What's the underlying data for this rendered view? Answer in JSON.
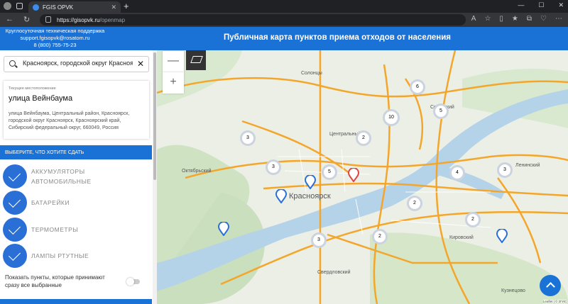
{
  "browser": {
    "tab_title": "FGIS OPVK",
    "url_domain": "https://gisopvk.ru",
    "url_path": "/openmap"
  },
  "header": {
    "support_line1": "Круглосуточная техническая поддержка",
    "support_email": "support.fgisopvk@rosatom.ru",
    "support_phone": "8 (800) 755-75-23",
    "title": "Публичная карта пунктов приема отходов от населения"
  },
  "sidebar": {
    "search_value": "Красноярск, городской округ Красноярск",
    "location_caption": "Текущее местоположение",
    "location_street": "улица Вейнбаума",
    "location_full": "улица Вейнбаума, Центральный район, Красноярск, городской округ Красноярск, Красноярский край, Сибирский федеральный округ, 660049, Россия",
    "choose_heading": "ВЫБЕРИТЕ, ЧТО ХОТИТЕ СДАТЬ",
    "items": [
      {
        "line1": "АККУМУЛЯТОРЫ",
        "line2": "АВТОМОБИЛЬНЫЕ"
      },
      {
        "line1": "БАТАРЕЙКИ"
      },
      {
        "line1": "ТЕРМОМЕТРЫ"
      },
      {
        "line1": "ЛАМПЫ РТУТНЫЕ"
      }
    ],
    "toggle_label_1": "Показать пункты, которые принимают",
    "toggle_label_2": "сразу все выбранные"
  },
  "map": {
    "zoom_out": "—",
    "zoom_in": "+",
    "city_label": "Красноярск",
    "labels": [
      "Солонцы",
      "Центральный",
      "Октябрьский",
      "Советский",
      "Ленинский",
      "Кировский",
      "Свердловский",
      "Кузнецово"
    ],
    "clusters": [
      "6",
      "5",
      "10",
      "3",
      "2",
      "3",
      "5",
      "4",
      "3",
      "2",
      "2",
      "3",
      "2"
    ],
    "attribution": "Leaflet | © 2ГИС",
    "accent": "#1a72d6",
    "road_color": "#f4a62a"
  }
}
